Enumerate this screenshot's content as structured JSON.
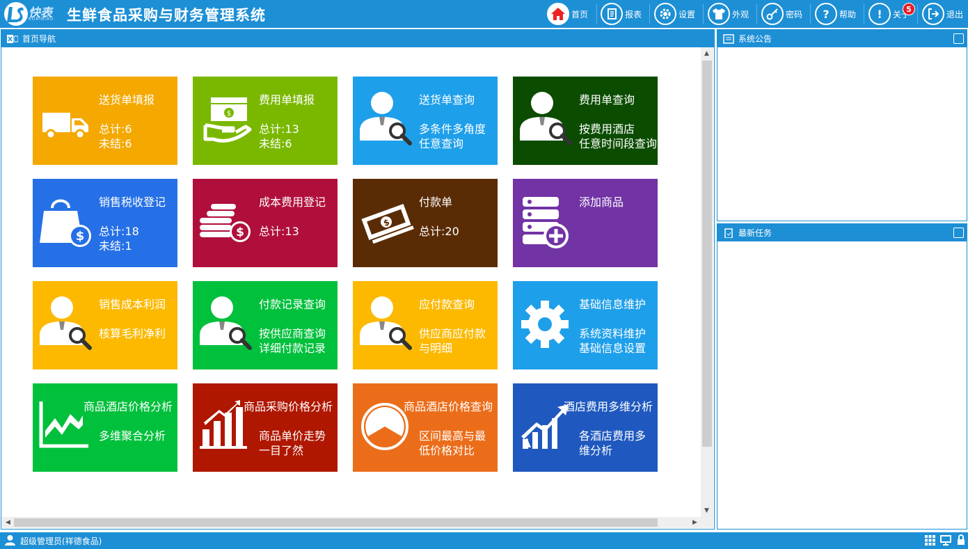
{
  "colors": {
    "bar": "#1d8fd5",
    "tile_yellow": "#f4a800",
    "tile_green": "#7ab800",
    "tile_blue": "#1e9fea",
    "tile_darkgreen": "#0b4c00",
    "tile_royal": "#2570e6",
    "tile_crimson": "#b00f3c",
    "tile_brown": "#5a2c05",
    "tile_purple": "#7233a5",
    "tile_gold": "#fcb900",
    "tile_green2": "#00c03c",
    "tile_red": "#af1700",
    "tile_orange": "#eb6d1a",
    "tile_cobalt": "#1f59bf"
  },
  "app": {
    "logo_text": "快表",
    "logo_sub": "KUAIBIAO",
    "title": "生鲜食品采购与财务管理系统"
  },
  "toolbar": {
    "home": "首页",
    "report": "报表",
    "settings": "设置",
    "appearance": "外观",
    "password": "密码",
    "help": "帮助",
    "about": "关于",
    "logout": "退出",
    "badge": "5"
  },
  "nav_panel": {
    "title": "首页导航"
  },
  "notice_panel": {
    "title": "系统公告"
  },
  "task_panel": {
    "title": "最新任务"
  },
  "tiles": [
    {
      "title": "送货单填报",
      "line1": "总计:6",
      "line2": "未结:6",
      "icon": "truck-icon"
    },
    {
      "title": "费用单填报",
      "line1": "总计:13",
      "line2": "未结:6",
      "icon": "cash-hand-icon"
    },
    {
      "title": "送货单查询",
      "line1": "多条件多角度",
      "line2": "任意查询",
      "icon": "user-search-icon"
    },
    {
      "title": "费用单查询",
      "line1": "按费用酒店",
      "line2": "任意时间段查询",
      "icon": "user-search-icon"
    },
    {
      "title": "销售税收登记",
      "line1": "总计:18",
      "line2": "未结:1",
      "icon": "money-bag-icon"
    },
    {
      "title": "成本费用登记",
      "line1": "总计:13",
      "line2": "",
      "icon": "coins-icon"
    },
    {
      "title": "付款单",
      "line1": "总计:20",
      "line2": "",
      "icon": "banknotes-icon"
    },
    {
      "title": "添加商品",
      "line1": "",
      "line2": "",
      "icon": "database-add-icon"
    },
    {
      "title": "销售成本利润",
      "line1": "核算毛利净利",
      "line2": "",
      "icon": "user-search-icon"
    },
    {
      "title": "付款记录查询",
      "line1": "按供应商查询",
      "line2": "详细付款记录",
      "icon": "user-search-icon"
    },
    {
      "title": "应付款查询",
      "line1": "供应商应付款",
      "line2": "与明细",
      "icon": "user-search-icon"
    },
    {
      "title": "基础信息维护",
      "line1": "系统资料维护",
      "line2": "基础信息设置",
      "icon": "gear-icon"
    },
    {
      "title": "商品酒店价格分析",
      "line1": "多维聚合分析",
      "line2": "",
      "icon": "area-chart-icon"
    },
    {
      "title": "商品采购价格分析",
      "line1": "商品单价走势",
      "line2": "一目了然",
      "icon": "bar-chart-icon"
    },
    {
      "title": "商品酒店价格查询",
      "line1": "区间最高与最",
      "line2": "低价格对比",
      "icon": "pie-chart-icon"
    },
    {
      "title": "酒店费用多维分析",
      "line1": "各酒店费用多",
      "line2": "维分析",
      "icon": "growth-chart-icon"
    }
  ],
  "status": {
    "user": "超级管理员(祥德食品)"
  }
}
